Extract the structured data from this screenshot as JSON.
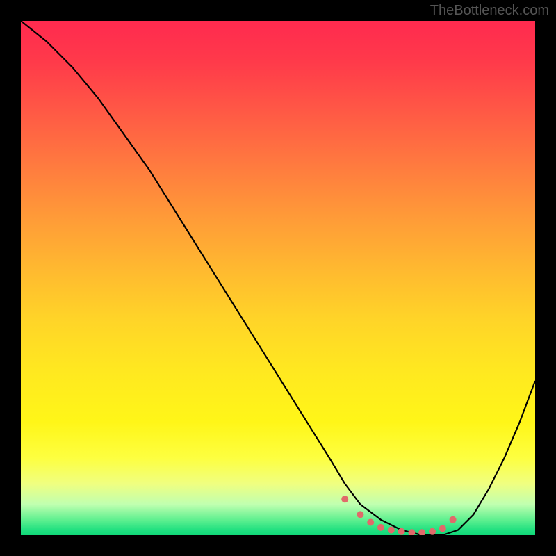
{
  "watermark": "TheBottleneck.com",
  "chart_data": {
    "type": "line",
    "title": "",
    "xlabel": "",
    "ylabel": "",
    "xlim": [
      0,
      100
    ],
    "ylim": [
      0,
      100
    ],
    "series": [
      {
        "name": "curve",
        "x": [
          0,
          5,
          10,
          15,
          20,
          25,
          30,
          35,
          40,
          45,
          50,
          55,
          60,
          63,
          66,
          70,
          74,
          78,
          82,
          85,
          88,
          91,
          94,
          97,
          100
        ],
        "y": [
          100,
          96,
          91,
          85,
          78,
          71,
          63,
          55,
          47,
          39,
          31,
          23,
          15,
          10,
          6,
          3,
          1,
          0,
          0,
          1,
          4,
          9,
          15,
          22,
          30
        ]
      }
    ],
    "markers": {
      "name": "highlight",
      "x": [
        63,
        66,
        68,
        70,
        72,
        74,
        76,
        78,
        80,
        82,
        84
      ],
      "y": [
        7,
        4,
        2.5,
        1.5,
        1,
        0.7,
        0.5,
        0.5,
        0.7,
        1.3,
        3
      ]
    },
    "gradient_colors": {
      "top": "#ff2a4f",
      "mid": "#ffd428",
      "bottom": "#20e080"
    }
  }
}
